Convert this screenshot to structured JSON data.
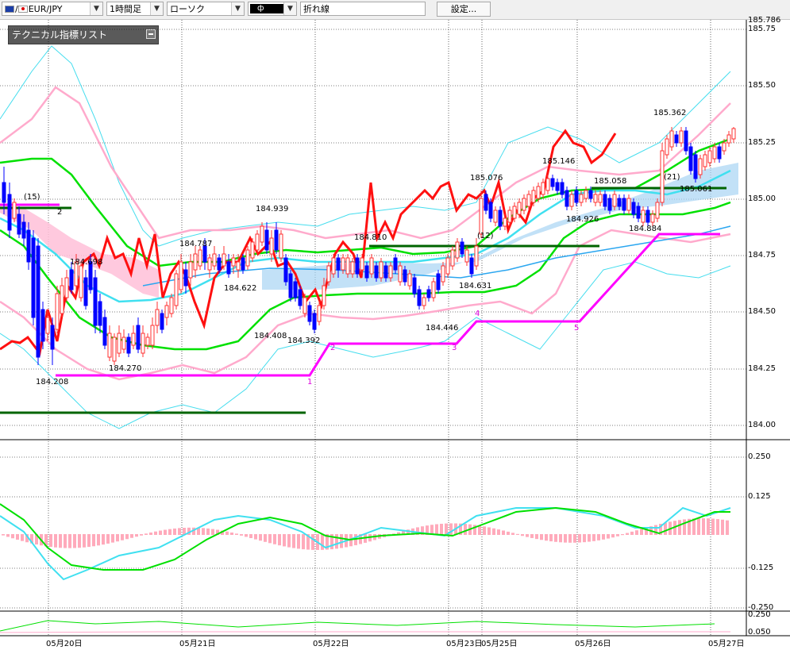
{
  "toolbar": {
    "pair": "EUR/JPY",
    "timeframe": "1時間足",
    "chart_type": "ローソク",
    "line_style": "折れ線",
    "settings_label": "設定..."
  },
  "indicator_panel": {
    "title": "テクニカル指標リスト"
  },
  "price_axis": [
    "185.75",
    "185.50",
    "185.25",
    "185.00",
    "184.75",
    "184.50",
    "184.25",
    "184.00"
  ],
  "price_axis_top": "185.786",
  "macd_axis": [
    "0.250",
    "0.125",
    "-0.125",
    "-0.250"
  ],
  "sub2_axis": [
    "0.250",
    "0.050"
  ],
  "date_labels": [
    "05月20日",
    "05月21日",
    "05月22日",
    "05月23日",
    "05月25日",
    "05月26日",
    "05月27日"
  ],
  "price_annotations": [
    "184.208",
    "184.270",
    "184.698",
    "184.787",
    "184.622",
    "184.939",
    "184.408",
    "184.392",
    "184.810",
    "184.446",
    "184.631",
    "185.076",
    "185.146",
    "184.926",
    "185.058",
    "184.884",
    "185.362",
    "185.061"
  ],
  "wave_labels": [
    "1",
    "2",
    "3",
    "4",
    "5"
  ],
  "count_labels": [
    "(15)",
    "2",
    "(12)",
    "(21)"
  ],
  "colors": {
    "red_line": "#ff0000",
    "magenta_line": "#ff00ff",
    "dark_green": "#006400",
    "bright_green": "#00e000",
    "cyan": "#00ccff",
    "pink": "#ffaacc",
    "bull_candle": "#ff3030",
    "bear_candle": "#0000ff",
    "cloud": "#ffc0d8",
    "cloud_blue": "#a8d4f4"
  }
}
